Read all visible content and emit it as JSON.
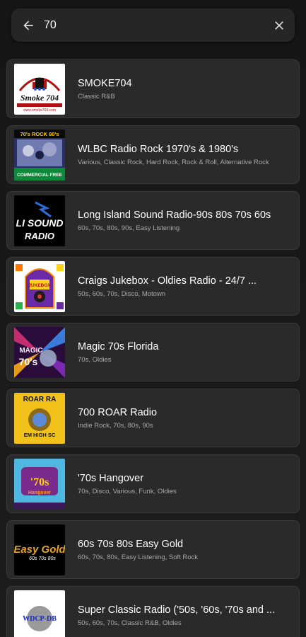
{
  "search": {
    "query": "70"
  },
  "icons": {
    "back": "arrow-left-icon",
    "clear": "close-icon"
  },
  "colors": {
    "background": "#1b1b1b",
    "card": "#2a2a2a",
    "text_primary": "#ffffff",
    "text_secondary": "#a9a9a9"
  },
  "results": [
    {
      "title": "SMOKE704",
      "tags": "Classic R&B",
      "logo": {
        "line1": "Smoke 704",
        "line2": "www.smoke704.com"
      }
    },
    {
      "title": "WLBC Radio Rock 1970's & 1980's",
      "tags": "Various, Classic Rock, Hard Rock, Rock & Roll, Alternative Rock",
      "logo": {
        "line1": "70's ROCK 80's",
        "line2": "COMMERCIAL FREE"
      }
    },
    {
      "title": "Long Island Sound Radio-90s 80s 70s 60s",
      "tags": "60s, 70s, 80s, 90s, Easy Listening",
      "logo": {
        "line1": "LI SOUND",
        "line2": "RADIO"
      }
    },
    {
      "title": "Craigs Jukebox - Oldies Radio - 24/7 ...",
      "tags": "50s, 60s, 70s, Disco, Motown",
      "logo": {
        "line1": "JUKEBOX",
        "line2": ""
      }
    },
    {
      "title": "Magic 70s Florida",
      "tags": "70s, Oldies",
      "logo": {
        "line1": "MAGIC",
        "line2": "70's"
      }
    },
    {
      "title": "700 ROAR Radio",
      "tags": "Indie Rock, 70s, 80s, 90s",
      "logo": {
        "line1": "ROAR RA",
        "line2": "EM HIGH SC"
      }
    },
    {
      "title": "'70s Hangover",
      "tags": "70s, Disco, Various, Funk, Oldies",
      "logo": {
        "line1": "'70s",
        "line2": "Hangover"
      }
    },
    {
      "title": " 60s 70s 80s Easy Gold",
      "tags": "60s, 70s, 80s, Easy Listening, Soft Rock",
      "logo": {
        "line1": "Easy Gold",
        "line2": "60s 70s 80s"
      }
    },
    {
      "title": "Super Classic Radio ('50s, '60s, '70s and ...",
      "tags": "50s, 60s, 70s, Classic R&B, Oldies",
      "logo": {
        "line1": "WDCP-DB",
        "line2": ""
      }
    }
  ]
}
